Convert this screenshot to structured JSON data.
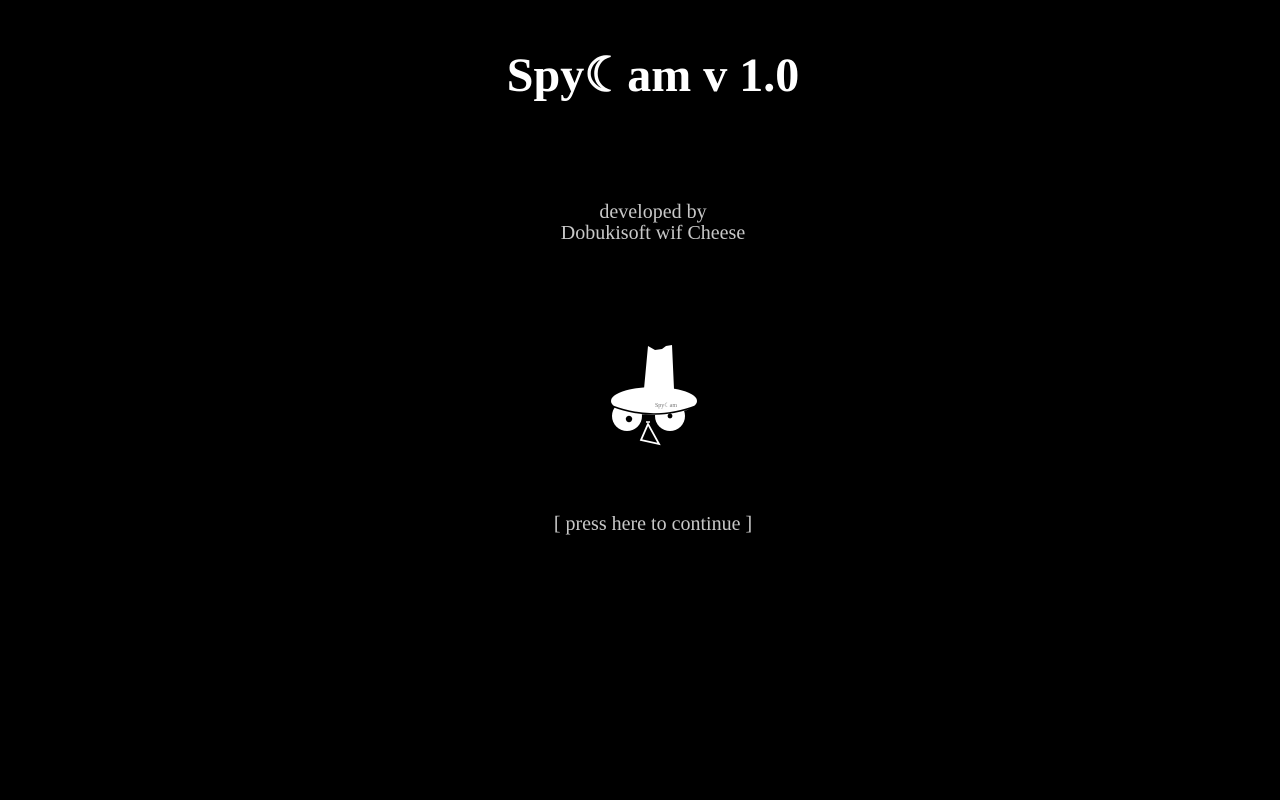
{
  "title": "Spy☾am v 1.0",
  "credit": {
    "line1": "developed by",
    "line2": "Dobukisoft wif Cheese"
  },
  "mascot": {
    "icon": "spy-hat-mascot-icon",
    "hat_label": "Spy☾am"
  },
  "continue_label": "[ press here to continue ]",
  "colors": {
    "background": "#000000",
    "title": "#ffffff",
    "credit": "#c8c8c8",
    "continue": "#c8c8c8",
    "mascot": "#ffffff"
  }
}
